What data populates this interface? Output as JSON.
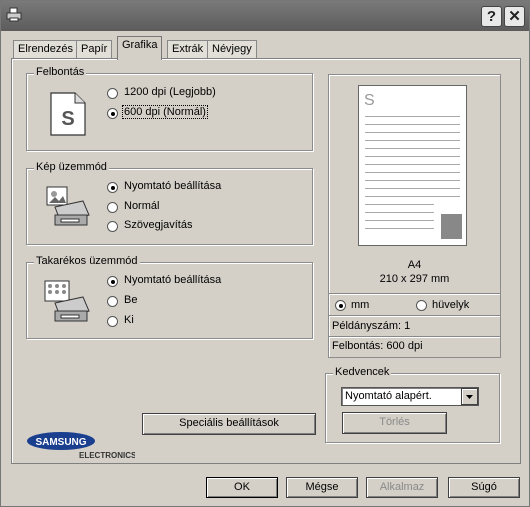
{
  "title_buttons": {
    "help": "?",
    "close": "✕"
  },
  "tabs": [
    "Elrendezés",
    "Papír",
    "Grafika",
    "Extrák",
    "Névjegy"
  ],
  "active_tab_index": 2,
  "resolution": {
    "label": "Felbontás",
    "options": [
      "1200 dpi (Legjobb)",
      "600 dpi (Normál)"
    ],
    "selected_index": 1,
    "icon_letter": "S"
  },
  "image_mode": {
    "label": "Kép üzemmód",
    "options": [
      "Nyomtató beállítása",
      "Normál",
      "Szövegjavítás"
    ],
    "selected_index": 0
  },
  "economy_mode": {
    "label": "Takarékos üzemmód",
    "options": [
      "Nyomtató beállítása",
      "Be",
      "Ki"
    ],
    "selected_index": 0
  },
  "preview": {
    "page_letter": "S",
    "paper_name": "A4",
    "paper_size": "210 x 297 mm",
    "unit_options": [
      "mm",
      "hüvelyk"
    ],
    "unit_selected_index": 0,
    "copies": "Példányszám: 1",
    "resolution": "Felbontás: 600 dpi"
  },
  "favorites": {
    "label": "Kedvencek",
    "selected_value": "Nyomtató alapért.",
    "delete_label": "Törlés"
  },
  "special_settings_label": "Speciális beállítások",
  "brand": {
    "line1": "SAMSUNG",
    "line2": "ELECTRONICS",
    "color": "#1b3f8f"
  },
  "footer_buttons": {
    "ok": "OK",
    "cancel": "Mégse",
    "apply": "Alkalmaz",
    "help": "Súgó"
  }
}
